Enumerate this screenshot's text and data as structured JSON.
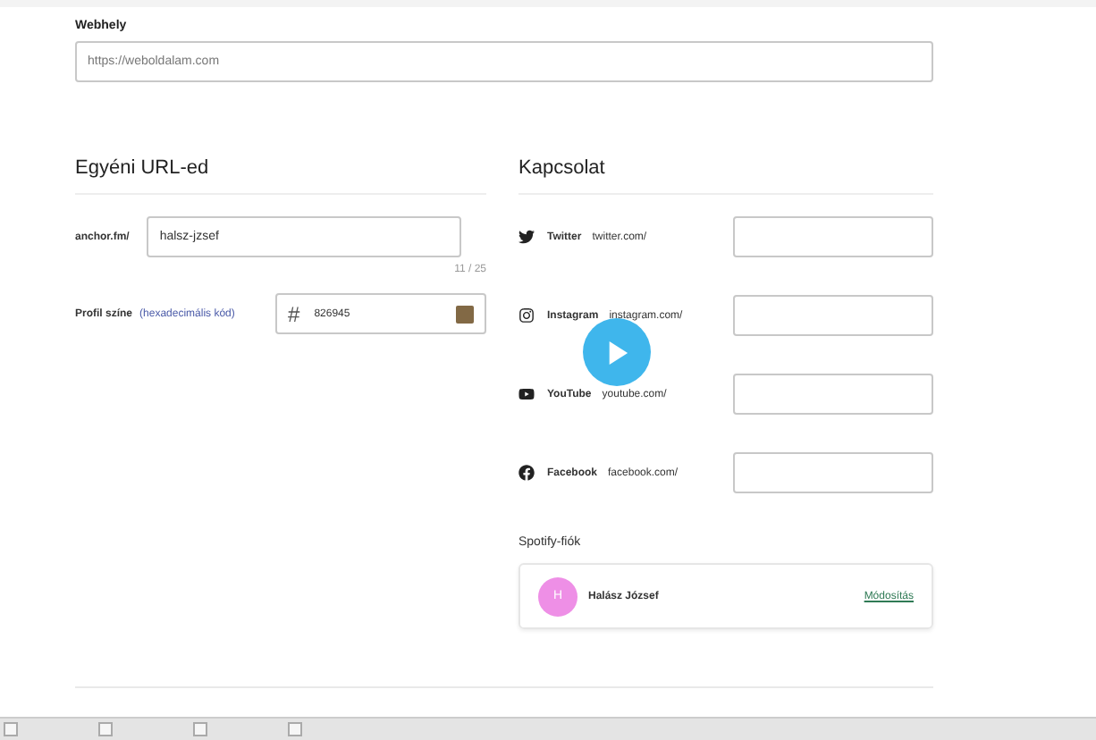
{
  "website": {
    "label": "Webhely",
    "placeholder": "https://weboldalam.com"
  },
  "custom_url": {
    "title": "Egyéni URL-ed",
    "prefix": "anchor.fm/",
    "value": "halsz-jzsef",
    "counter": "11 / 25",
    "color_label": "Profil színe",
    "color_hint": "(hexadecimális kód)",
    "hash": "#",
    "color_value": "826945",
    "color": "#826945"
  },
  "contact": {
    "title": "Kapcsolat",
    "links": [
      {
        "kind": "twitter",
        "name": "Twitter",
        "domain": "twitter.com/"
      },
      {
        "kind": "instagram",
        "name": "Instagram",
        "domain": "instagram.com/"
      },
      {
        "kind": "youtube",
        "name": "YouTube",
        "domain": "youtube.com/"
      },
      {
        "kind": "facebook",
        "name": "Facebook",
        "domain": "facebook.com/"
      }
    ]
  },
  "spotify": {
    "title": "Spotify-fiók",
    "initial": "H",
    "name": "Halász József",
    "action": "Módosítás"
  }
}
